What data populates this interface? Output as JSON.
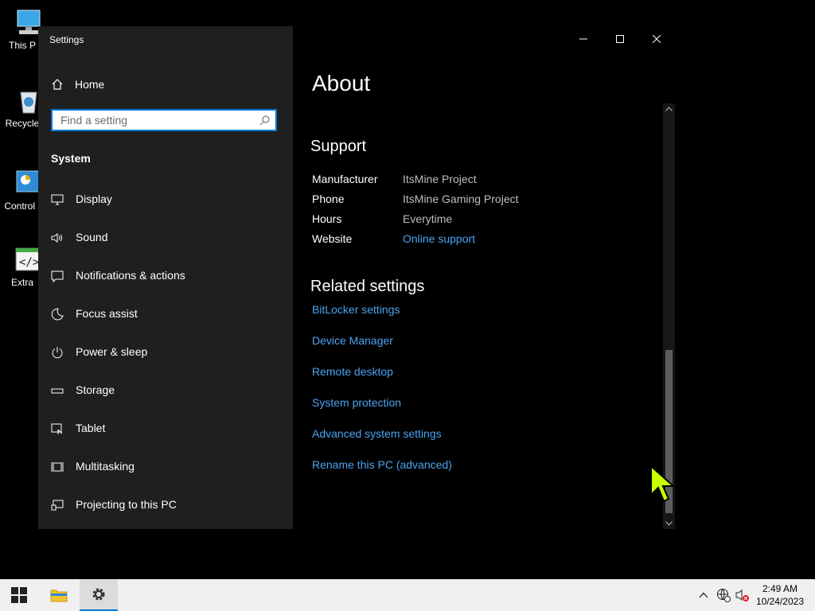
{
  "desktop": {
    "icons": [
      {
        "label": "This P",
        "icon": "computer-icon"
      },
      {
        "label": "Recycle",
        "icon": "recycle-bin-icon"
      },
      {
        "label": "Control I",
        "icon": "control-panel-icon"
      },
      {
        "label": "Extra",
        "icon": "script-icon"
      }
    ]
  },
  "window": {
    "title": "Settings",
    "home_label": "Home",
    "search_placeholder": "Find a setting",
    "section_label": "System",
    "nav": [
      {
        "label": "Display",
        "icon": "display-icon"
      },
      {
        "label": "Sound",
        "icon": "sound-icon"
      },
      {
        "label": "Notifications & actions",
        "icon": "notifications-icon"
      },
      {
        "label": "Focus assist",
        "icon": "moon-icon"
      },
      {
        "label": "Power & sleep",
        "icon": "power-icon"
      },
      {
        "label": "Storage",
        "icon": "storage-icon"
      },
      {
        "label": "Tablet",
        "icon": "tablet-icon"
      },
      {
        "label": "Multitasking",
        "icon": "multitasking-icon"
      },
      {
        "label": "Projecting to this PC",
        "icon": "projecting-icon"
      }
    ]
  },
  "content": {
    "page_title": "About",
    "support_heading": "Support",
    "support": [
      {
        "key": "Manufacturer",
        "value": "ItsMine Project"
      },
      {
        "key": "Phone",
        "value": "ItsMine Gaming Project"
      },
      {
        "key": "Hours",
        "value": "Everytime"
      },
      {
        "key": "Website",
        "value": "Online support"
      }
    ],
    "related_heading": "Related settings",
    "related": [
      "BitLocker settings",
      "Device Manager",
      "Remote desktop",
      "System protection",
      "Advanced system settings",
      "Rename this PC (advanced)"
    ]
  },
  "taskbar": {
    "time": "2:49 AM",
    "date": "10/24/2023"
  },
  "colors": {
    "accent": "#0078d7",
    "link": "#4aa3f0",
    "cursor": "#c6ff00"
  }
}
